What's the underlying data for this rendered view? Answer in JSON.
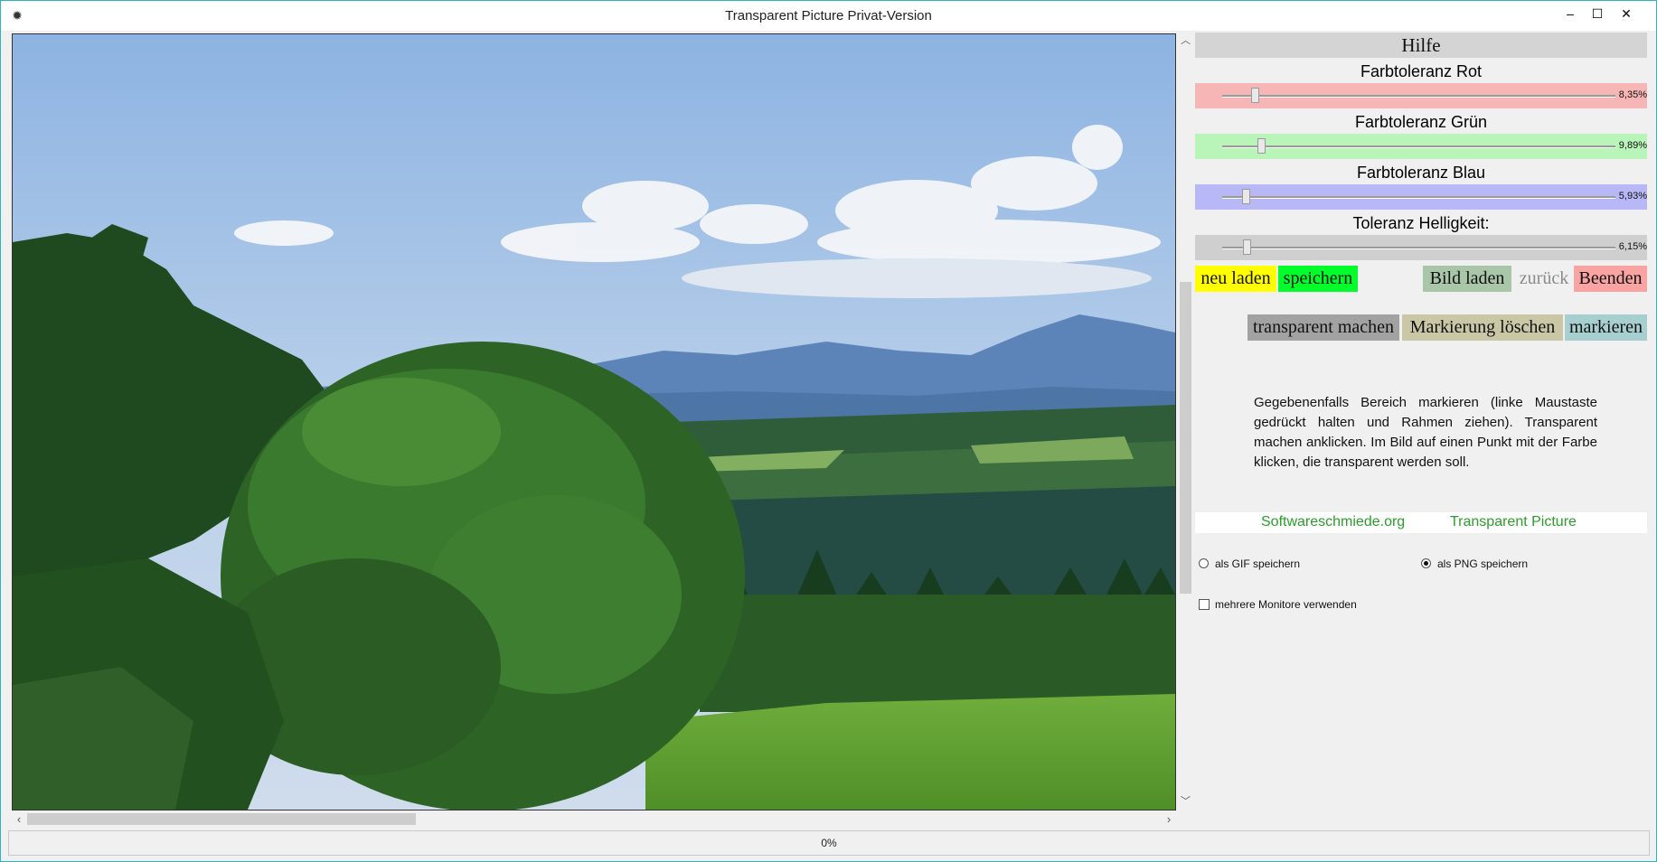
{
  "window": {
    "title": "Transparent Picture Privat-Version",
    "minimize": "–",
    "maximize": "☐",
    "close": "✕"
  },
  "panel": {
    "help_button": "Hilfe",
    "sliders": [
      {
        "label": "Farbtoleranz Rot",
        "value": "8,35%",
        "fraction": 0.0835,
        "color": "#f7b6b6"
      },
      {
        "label": "Farbtoleranz Grün",
        "value": "9,89%",
        "fraction": 0.0989,
        "color": "#b9f5b9"
      },
      {
        "label": "Farbtoleranz Blau",
        "value": "5,93%",
        "fraction": 0.0593,
        "color": "#b7b8f5"
      },
      {
        "label": "Toleranz Helligkeit:",
        "value": "6,15%",
        "fraction": 0.0615,
        "color": "#cfcfcf"
      }
    ],
    "buttons": {
      "neu_laden": "neu laden",
      "speichern": "speichern",
      "bild_laden": "Bild laden",
      "zurueck": "zurück",
      "beenden": "Beenden",
      "transparent_machen": "transparent machen",
      "markierung_loeschen": "Markierung löschen",
      "markieren": "markieren"
    },
    "help_text": "Gegebenenfalls Bereich markieren (linke Maustaste gedrückt halten und Rahmen ziehen). Transparent machen anklicken. Im Bild auf einen Punkt mit der Farbe klicken, die transparent werden soll.",
    "links": {
      "site": "Softwareschmiede.org",
      "product": "Transparent Picture"
    },
    "format_options": {
      "gif_label": "als GIF speichern",
      "png_label": "als PNG speichern",
      "selected": "png"
    },
    "multi_monitor": {
      "label": "mehrere Monitore verwenden",
      "checked": false
    }
  },
  "status": {
    "progress": "0%"
  },
  "colors": {
    "yellow": "#ffff00",
    "green": "#00ff2a",
    "bild_laden": "#a9c6a9",
    "beenden": "#f9a3a3",
    "transparent_machen": "#a2a2a2",
    "markierung_loeschen": "#c9c7a6",
    "markieren": "#a7cfcf",
    "link": "#2a9d2a"
  },
  "icons": {
    "app": "app-icon",
    "scroll_up": "chevron-up-icon",
    "scroll_down": "chevron-down-icon",
    "scroll_left": "chevron-left-icon",
    "scroll_right": "chevron-right-icon"
  }
}
